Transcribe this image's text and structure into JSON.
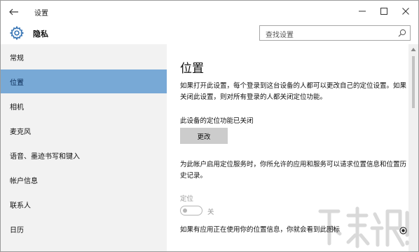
{
  "titlebar": {
    "title": "设置",
    "back_icon": "back-arrow-icon",
    "minimize_icon": "minimize-icon",
    "maximize_icon": "maximize-icon",
    "close_icon": "close-icon"
  },
  "header": {
    "icon": "gear-icon",
    "title": "隐私",
    "search_placeholder": "查找设置",
    "search_icon": "search-icon"
  },
  "sidebar": {
    "items": [
      {
        "label": "常规",
        "active": false
      },
      {
        "label": "位置",
        "active": true
      },
      {
        "label": "相机",
        "active": false
      },
      {
        "label": "麦克风",
        "active": false
      },
      {
        "label": "语音、墨迹书写和键入",
        "active": false
      },
      {
        "label": "帐户信息",
        "active": false
      },
      {
        "label": "联系人",
        "active": false
      },
      {
        "label": "日历",
        "active": false
      }
    ]
  },
  "main": {
    "title": "位置",
    "intro": "如果打开此设置，每个登录到这台设备的人都可以更改自己的定位设置。如果关闭此设置，则对所有登录的人都关闭定位功能。",
    "device_status": "此设备的定位功能已关闭",
    "change_button": "更改",
    "account_desc": "为此帐户启用定位服务时，你所允许的应用和服务可以请求位置信息和位置历史记录。",
    "location_label": "定位",
    "toggle_state": "关",
    "toggle_on": false,
    "icon_note": "如果有应用正在使用你的位置信息，你就会看到此图标",
    "location_icon": "location-in-use-icon"
  },
  "colors": {
    "accent_selected": "#78a9d6",
    "sidebar_bg": "#f2f2f2",
    "button_bg": "#cccccc",
    "disabled_text": "#9a9a9a"
  }
}
